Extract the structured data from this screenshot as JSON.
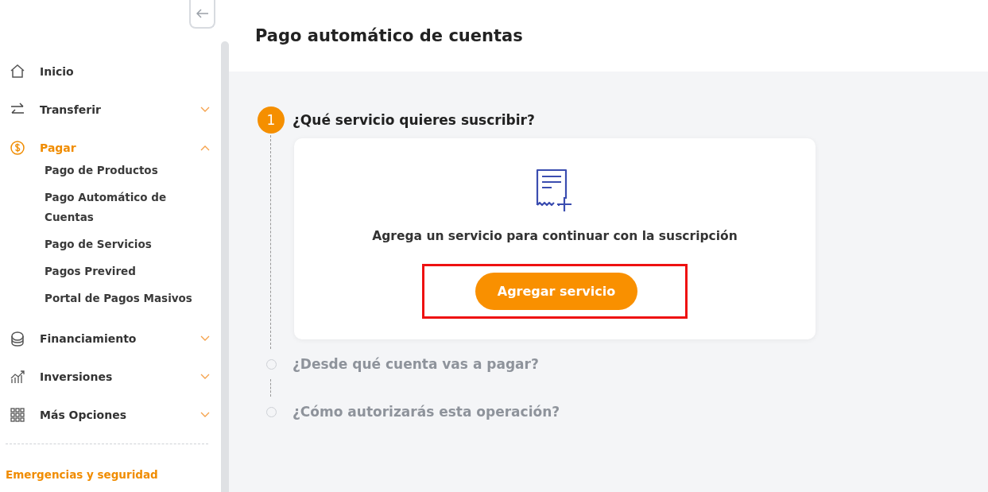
{
  "sidebar": {
    "items": [
      {
        "label": "Inicio",
        "selected": false
      },
      {
        "label": "Transferir",
        "selected": false,
        "expanded": false
      },
      {
        "label": "Pagar",
        "selected": true,
        "expanded": true,
        "children": [
          {
            "label": "Pago de Productos"
          },
          {
            "label": "Pago Automático de Cuentas"
          },
          {
            "label": "Pago de Servicios"
          },
          {
            "label": "Pagos Previred"
          },
          {
            "label": "Portal de Pagos Masivos"
          }
        ]
      },
      {
        "label": "Financiamiento",
        "selected": false,
        "expanded": false
      },
      {
        "label": "Inversiones",
        "selected": false,
        "expanded": false
      },
      {
        "label": "Más Opciones",
        "selected": false,
        "expanded": false
      }
    ],
    "section_title": "Emergencias y seguridad"
  },
  "page": {
    "title": "Pago automático de cuentas"
  },
  "steps": [
    {
      "number": "1",
      "title": "¿Qué servicio quieres suscribir?",
      "active": true,
      "card": {
        "message": "Agrega un servicio para continuar con la suscripción",
        "button": {
          "label": "Agregar servicio",
          "highlighted": true
        }
      }
    },
    {
      "title": "¿Desde qué cuenta vas a pagar?",
      "active": false
    },
    {
      "title": "¿Cómo autorizarás esta operación?",
      "active": false
    }
  ]
}
